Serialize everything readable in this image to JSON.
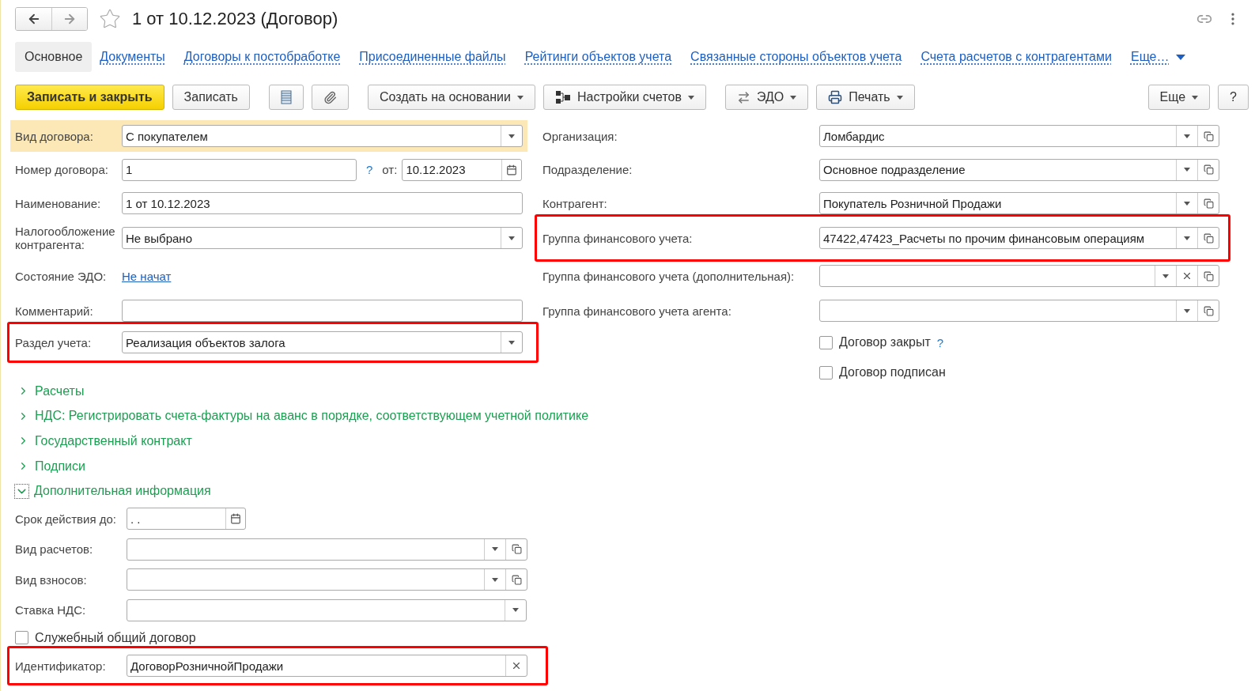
{
  "header": {
    "title": "1 от 10.12.2023 (Договор)",
    "favorite": false
  },
  "tabs": [
    {
      "label": "Основное",
      "selected": true
    },
    {
      "label": "Документы",
      "selected": false
    },
    {
      "label": "Договоры к постобработке",
      "selected": false
    },
    {
      "label": "Присоединенные файлы",
      "selected": false
    },
    {
      "label": "Рейтинги объектов учета",
      "selected": false
    },
    {
      "label": "Связанные стороны объектов учета",
      "selected": false
    },
    {
      "label": "Счета расчетов с контрагентами",
      "selected": false
    },
    {
      "label": "Еще…",
      "selected": false,
      "kind": "more"
    }
  ],
  "toolbar": {
    "left": [
      {
        "kind": "primary",
        "label": "Записать и закрыть"
      },
      {
        "kind": "plain",
        "label": "Записать"
      },
      {
        "kind": "list"
      },
      {
        "kind": "attach"
      },
      {
        "kind": "menu",
        "label": "Создать на основании"
      },
      {
        "kind": "accounts",
        "label": "Настройки счетов"
      },
      {
        "kind": "exchange",
        "label": "ЭДО"
      },
      {
        "kind": "print",
        "label": "Печать"
      }
    ],
    "right": [
      {
        "kind": "menu",
        "label": "Еще"
      },
      {
        "kind": "plain",
        "label": "?"
      }
    ]
  },
  "left_fields": [
    {
      "kind": "select",
      "label": "Вид договора:",
      "value": "С покупателем",
      "focused": true,
      "highlighted": false
    },
    {
      "kind": "number",
      "label": "Номер договора:",
      "value": "1",
      "help": "?",
      "date_label": "от:",
      "date_value": "10.12.2023",
      "focused": false,
      "highlighted": false
    },
    {
      "kind": "input",
      "label": "Наименование:",
      "value": "1 от 10.12.2023",
      "focused": false,
      "highlighted": false
    },
    {
      "kind": "select",
      "label": "Налогообложение контрагента:",
      "value": "Не выбрано",
      "focused": false,
      "highlighted": false
    },
    {
      "kind": "link",
      "label": "Состояние ЭДО:",
      "value": "Не начат",
      "focused": false,
      "highlighted": false
    },
    {
      "kind": "input",
      "label": "Комментарий:",
      "focused": false,
      "highlighted": false
    },
    {
      "kind": "select",
      "label": "Раздел учета:",
      "value": "Реализация объектов залога",
      "focused": false,
      "highlighted": true
    }
  ],
  "right_fields": [
    {
      "kind": "choice",
      "label": "Организация:",
      "value": "Ломбардис",
      "highlighted": false
    },
    {
      "kind": "choice",
      "label": "Подразделение:",
      "value": "Основное подразделение",
      "highlighted": false
    },
    {
      "kind": "choice",
      "label": "Контрагент:",
      "value": "Покупатель Розничной Продажи",
      "highlighted": false
    },
    {
      "kind": "choice",
      "label": "Группа финансового учета:",
      "value": "47422,47423_Расчеты по прочим финансовым операциям",
      "highlighted": true
    },
    {
      "kind": "clearable",
      "label": "Группа финансового учета (дополнительная):",
      "highlighted": false
    },
    {
      "kind": "choice",
      "label": "Группа финансового учета агента:",
      "highlighted": false
    },
    {
      "kind": "checkbox",
      "label": "Договор закрыт",
      "help": "?",
      "checked": false,
      "highlighted": false
    },
    {
      "kind": "checkbox",
      "label": "Договор подписан",
      "checked": false,
      "highlighted": false
    }
  ],
  "sections": [
    {
      "label": "Расчеты",
      "expanded": false
    },
    {
      "label": "НДС: Регистрировать счета-фактуры на аванс в порядке, соответствующем учетной политике",
      "expanded": false
    },
    {
      "label": "Государственный контракт",
      "expanded": false
    },
    {
      "label": "Подписи",
      "expanded": false
    },
    {
      "label": "Дополнительная информация",
      "expanded": true
    }
  ],
  "extra_fields": [
    {
      "kind": "date",
      "label": "Срок действия до:",
      "value": ".  .",
      "highlighted": false
    },
    {
      "kind": "choice",
      "label": "Вид расчетов:",
      "highlighted": false
    },
    {
      "kind": "choice",
      "label": "Вид взносов:",
      "highlighted": false
    },
    {
      "kind": "select",
      "label": "Ставка НДС:",
      "highlighted": false
    },
    {
      "kind": "checkbox",
      "label": "Служебный общий договор",
      "checked": false,
      "highlighted": false
    },
    {
      "kind": "clear",
      "label": "Идентификатор:",
      "value": "ДоговорРозничнойПродажи",
      "highlighted": true
    }
  ]
}
